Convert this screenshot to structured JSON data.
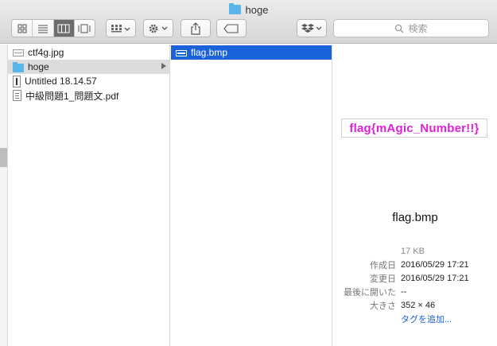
{
  "window": {
    "title": "hoge"
  },
  "toolbar": {
    "view_buttons": [
      "icon-view",
      "list-view",
      "column-view",
      "cover-flow-view"
    ],
    "active_view": "column-view",
    "search_placeholder": "検索"
  },
  "column1": {
    "items": [
      {
        "name": "ctf4g.jpg",
        "icon": "image-file-icon"
      },
      {
        "name": "hoge",
        "icon": "folder-icon",
        "selected": true,
        "has_children": true
      },
      {
        "name": "Untitled 18.14.57",
        "icon": "executable-file-icon"
      },
      {
        "name": "中級問題1_問題文.pdf",
        "icon": "pdf-file-icon"
      }
    ]
  },
  "column2": {
    "items": [
      {
        "name": "flag.bmp",
        "icon": "bitmap-file-icon",
        "selected": true
      }
    ]
  },
  "preview": {
    "thumbnail_text": "flag{mAgic_Number!!}",
    "filename": "flag.bmp",
    "size": "17 KB",
    "rows": [
      {
        "key": "作成日",
        "value": "2016/05/29 17:21"
      },
      {
        "key": "変更日",
        "value": "2016/05/29 17:21"
      },
      {
        "key": "最後に開いた",
        "value": "--"
      },
      {
        "key": "大きさ",
        "value": "352 × 46"
      }
    ],
    "add_tags": "タグを追加..."
  },
  "colors": {
    "selection_blue": "#1a62d9",
    "flag_magenta": "#e01fd8",
    "folder_blue": "#5ab6ea"
  }
}
